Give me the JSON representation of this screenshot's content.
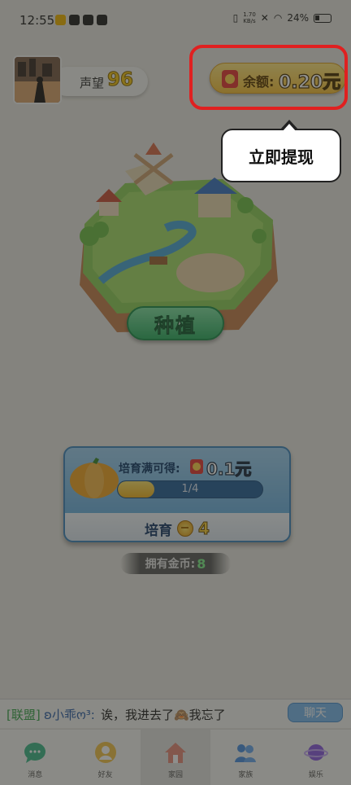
{
  "status_bar": {
    "time": "12:55",
    "net_speed": "1.70",
    "net_unit": "KB/s",
    "battery": "24%"
  },
  "profile": {
    "prestige_label": "声望",
    "prestige_value": "96"
  },
  "balance": {
    "label": "余额:",
    "value": "0.20元"
  },
  "tooltip": {
    "text": "立即提现"
  },
  "main": {
    "plant_button": "种植"
  },
  "cultivation_card": {
    "reward_label": "培育满可得:",
    "reward_value": "0.1元",
    "progress_text": "1/4",
    "progress_fraction": 0.25,
    "cultivate_label": "培育",
    "cultivate_cost": "4"
  },
  "coins": {
    "label": "拥有金币:",
    "value": "8"
  },
  "chat": {
    "tag": "[联盟]",
    "sender": "ʚ小乖ო³:",
    "text": "诶，我进去了🙈我忘了",
    "button": "聊天"
  },
  "bottom_nav": {
    "items": [
      {
        "label": "消息",
        "icon": "chat-bubble-icon"
      },
      {
        "label": "好友",
        "icon": "friend-icon"
      },
      {
        "label": "家园",
        "icon": "home-icon"
      },
      {
        "label": "家族",
        "icon": "family-icon"
      },
      {
        "label": "娱乐",
        "icon": "planet-icon"
      }
    ],
    "active_index": 2
  },
  "colors": {
    "accent_red": "#e02020",
    "balance_gold": "#f7c13a",
    "plant_green": "#2fae64",
    "card_blue": "#5aa6dc"
  }
}
